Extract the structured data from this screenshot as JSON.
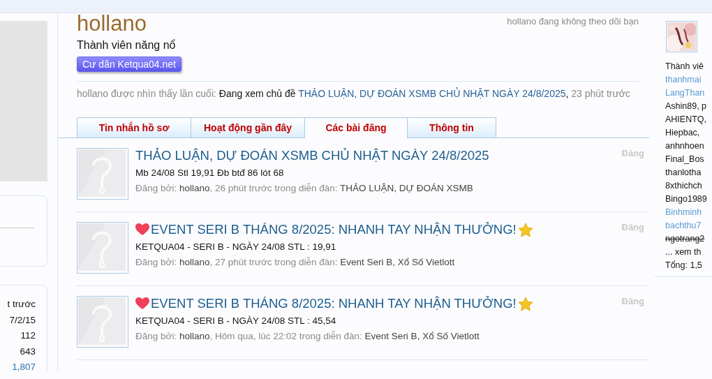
{
  "profile": {
    "name": "hollano",
    "title": "Thành viên năng nổ",
    "banner": "Cư dân Ketqua04.net",
    "follow_status": "hollano đang không theo dõi bạn",
    "last_seen": {
      "label": "hollano được nhìn thấy lần cuối:",
      "activity": "Đang xem chủ đề",
      "thread": "THẢO LUẬN, DỰ ĐOÁN XSMB CHỦ NHẬT NGÀY 24/8/2025",
      "punct": ",",
      "time": "23 phút trước"
    }
  },
  "tabs": [
    {
      "label": "Tin nhắn hồ sơ",
      "selected": false
    },
    {
      "label": "Hoạt động gần đây",
      "selected": false
    },
    {
      "label": "Các bài đăng",
      "selected": true
    },
    {
      "label": "Thông tin",
      "selected": false
    }
  ],
  "posts": [
    {
      "title": "THẢO LUẬN, DỰ ĐOÁN XSMB CHỦ NHẬT NGÀY 24/8/2025",
      "decorated": false,
      "snippet": "Mb 24/08 Stl 19,91 Đb btđ 86 lót 68",
      "by_label": "Đăng bởi:",
      "author": "hollano",
      "time": ", 26 phút trước trong diễn đàn:",
      "forum": "THẢO LUẬN, DỰ ĐOÁN XSMB",
      "type": "Đăng"
    },
    {
      "title": "EVENT SERI B THÁNG 8/2025: NHANH TAY NHẬN THƯỞNG!",
      "decorated": true,
      "snippet": "KETQUA04 - SERI B - NGÀY 24/08 STL : 19,91",
      "by_label": "Đăng bởi:",
      "author": "hollano",
      "time": ", 27 phút trước trong diễn đàn:",
      "forum": "Event Seri B, Xổ Số Vietlott",
      "type": "Đăng"
    },
    {
      "title": "EVENT SERI B THÁNG 8/2025: NHANH TAY NHẬN THƯỞNG!",
      "decorated": true,
      "snippet": "KETQUA04 - SERI B - NGÀY 24/08 STL : 45,54",
      "by_label": "Đăng bởi:",
      "author": "hollano",
      "time": ", Hôm qua, lúc 22:02 trong diễn đàn:",
      "forum": "Event Seri B, Xổ Số Vietlott",
      "type": "Đăng"
    }
  ],
  "left_stats": [
    {
      "text": "t trước",
      "kind": "value"
    },
    {
      "text": "7/2/15",
      "kind": "value"
    },
    {
      "text": "112",
      "kind": "value"
    },
    {
      "text": "643",
      "kind": "value"
    },
    {
      "text": "1,807",
      "kind": "link"
    }
  ],
  "online": {
    "label": "Thành viê",
    "members": [
      {
        "name": "thanhmai",
        "kind": "staff"
      },
      {
        "name": "LangThan",
        "kind": "staff"
      },
      {
        "name": "Ashin89, p",
        "kind": "member"
      },
      {
        "name": "AHIENTQ,",
        "kind": "member"
      },
      {
        "name": "Hiepbac,",
        "kind": "member"
      },
      {
        "name": "anhnhoen",
        "kind": "member"
      },
      {
        "name": "Final_Bos",
        "kind": "member"
      },
      {
        "name": "thanlotha",
        "kind": "member"
      },
      {
        "name": "8xthichch",
        "kind": "member"
      },
      {
        "name": "Bingo1989",
        "kind": "member"
      },
      {
        "name": "Binhminh",
        "kind": "staff"
      },
      {
        "name": "bachthu7",
        "kind": "staff"
      },
      {
        "name": "ngotrang2",
        "kind": "banned"
      }
    ],
    "more": "... xem th",
    "total": "Tổng: 1,5"
  }
}
